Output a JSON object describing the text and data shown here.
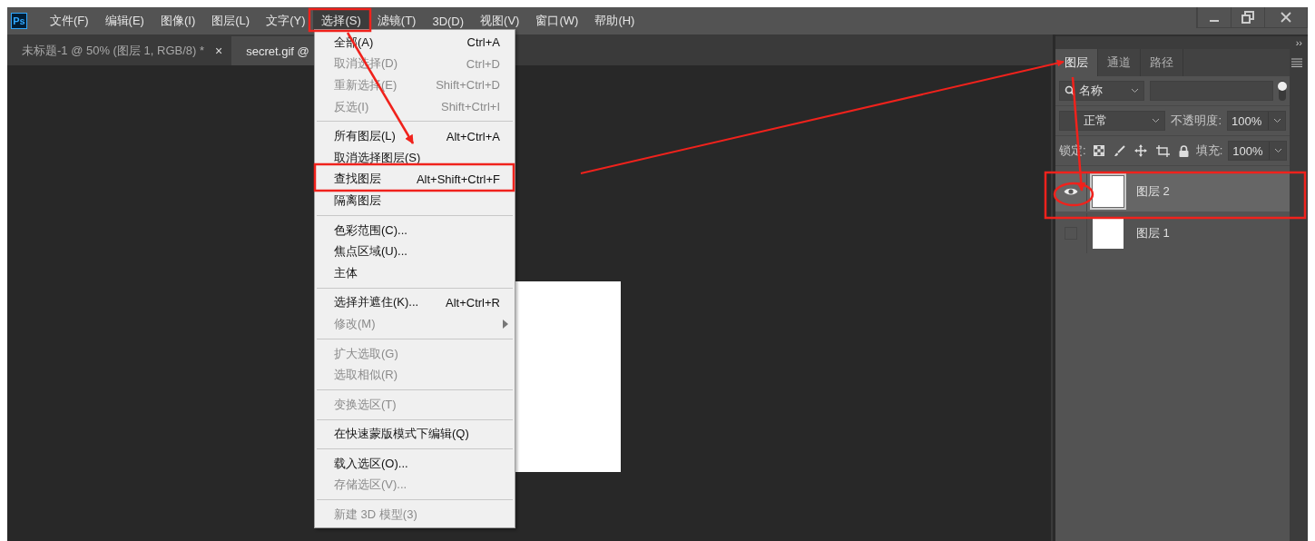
{
  "app": {
    "logo": "Ps"
  },
  "menu_bar": [
    {
      "label": "文件(F)",
      "selected": false
    },
    {
      "label": "编辑(E)",
      "selected": false
    },
    {
      "label": "图像(I)",
      "selected": false
    },
    {
      "label": "图层(L)",
      "selected": false
    },
    {
      "label": "文字(Y)",
      "selected": false
    },
    {
      "label": "选择(S)",
      "selected": true
    },
    {
      "label": "滤镜(T)",
      "selected": false
    },
    {
      "label": "3D(D)",
      "selected": false
    },
    {
      "label": "视图(V)",
      "selected": false
    },
    {
      "label": "窗口(W)",
      "selected": false
    },
    {
      "label": "帮助(H)",
      "selected": false
    }
  ],
  "document_tabs": [
    {
      "label": "未标题-1 @ 50% (图层 1, RGB/8) *",
      "close": "×",
      "selected": false
    },
    {
      "label": "secret.gif @",
      "selected": true
    }
  ],
  "select_menu": [
    {
      "kind": "item",
      "label": "全部(A)",
      "shortcut": "Ctrl+A",
      "disabled": false
    },
    {
      "kind": "item",
      "label": "取消选择(D)",
      "shortcut": "Ctrl+D",
      "disabled": true
    },
    {
      "kind": "item",
      "label": "重新选择(E)",
      "shortcut": "Shift+Ctrl+D",
      "disabled": true
    },
    {
      "kind": "item",
      "label": "反选(I)",
      "shortcut": "Shift+Ctrl+I",
      "disabled": true
    },
    {
      "kind": "separator"
    },
    {
      "kind": "item",
      "label": "所有图层(L)",
      "shortcut": "Alt+Ctrl+A",
      "disabled": false
    },
    {
      "kind": "item",
      "label": "取消选择图层(S)",
      "disabled": false
    },
    {
      "kind": "item",
      "label": "查找图层",
      "shortcut": "Alt+Shift+Ctrl+F",
      "disabled": false
    },
    {
      "kind": "item",
      "label": "隔离图层",
      "disabled": false
    },
    {
      "kind": "separator"
    },
    {
      "kind": "item",
      "label": "色彩范围(C)...",
      "disabled": false
    },
    {
      "kind": "item",
      "label": "焦点区域(U)...",
      "disabled": false
    },
    {
      "kind": "item",
      "label": "主体",
      "disabled": false
    },
    {
      "kind": "separator"
    },
    {
      "kind": "item",
      "label": "选择并遮住(K)...",
      "shortcut": "Alt+Ctrl+R",
      "disabled": false
    },
    {
      "kind": "submenu",
      "label": "修改(M)",
      "disabled": true
    },
    {
      "kind": "separator"
    },
    {
      "kind": "item",
      "label": "扩大选取(G)",
      "disabled": true
    },
    {
      "kind": "item",
      "label": "选取相似(R)",
      "disabled": true
    },
    {
      "kind": "separator"
    },
    {
      "kind": "item",
      "label": "变换选区(T)",
      "disabled": true
    },
    {
      "kind": "separator"
    },
    {
      "kind": "item",
      "label": "在快速蒙版模式下编辑(Q)",
      "disabled": false
    },
    {
      "kind": "separator"
    },
    {
      "kind": "item",
      "label": "载入选区(O)...",
      "disabled": false
    },
    {
      "kind": "item",
      "label": "存储选区(V)...",
      "disabled": true
    },
    {
      "kind": "separator"
    },
    {
      "kind": "item",
      "label": "新建 3D 模型(3)",
      "disabled": true
    }
  ],
  "layers_panel": {
    "collapse": "››",
    "tabs": [
      {
        "label": "图层",
        "selected": true
      },
      {
        "label": "通道",
        "selected": false
      },
      {
        "label": "路径",
        "selected": false
      }
    ],
    "filter": {
      "value": "名称"
    },
    "blend_mode": {
      "value": "正常"
    },
    "opacity": {
      "label": "不透明度:",
      "value": "100%"
    },
    "lock": {
      "label": "锁定:"
    },
    "fill": {
      "label": "填充:",
      "value": "100%"
    },
    "layers": [
      {
        "name": "图层 2",
        "visible": true,
        "selected": true
      },
      {
        "name": "图层 1",
        "visible": false,
        "selected": false
      }
    ]
  }
}
